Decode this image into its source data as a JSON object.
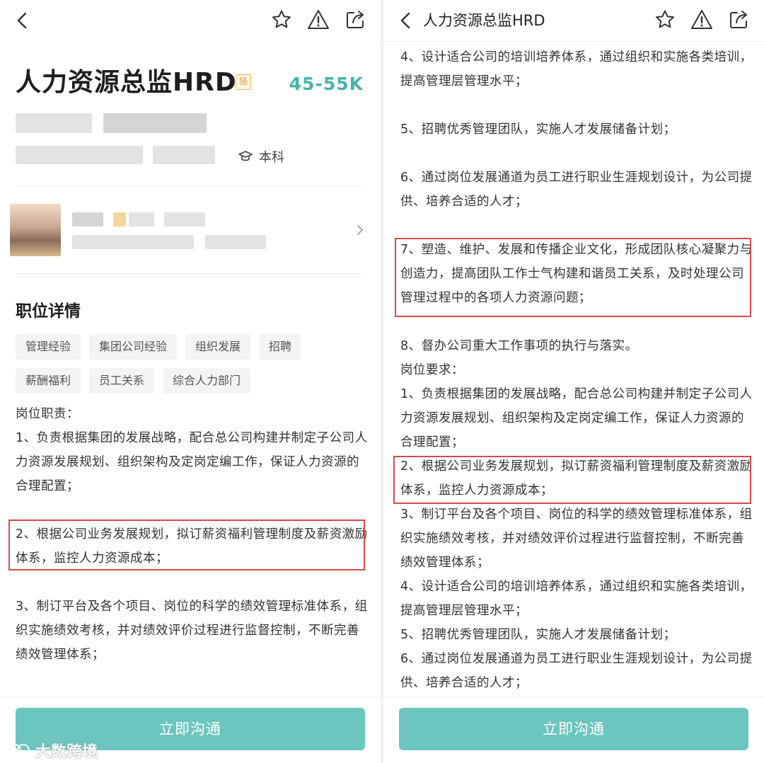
{
  "left": {
    "job_title": "人力资源总监HRD",
    "badge": "猎",
    "salary": "45-55K",
    "education": "本科",
    "section_title": "职位详情",
    "tags": [
      "管理经验",
      "集团公司经验",
      "组织发展",
      "招聘",
      "薪酬福利",
      "员工关系",
      "综合人力部门"
    ],
    "duties_heading": "岗位职责：",
    "duty_1": "1、负责根据集团的发展战略，配合总公司构建并制定子公司人力资源发展规划、组织架构及定岗定编工作，保证人力资源的合理配置；",
    "duty_2": "2、根据公司业务发展规划，拟订薪资福利管理制度及薪资激励体系，监控人力资源成本；",
    "duty_3": "3、制订平台及各个项目、岗位的科学的绩效管理标准体系，组织实施绩效考核，并对绩效评价过程进行监督控制，不断完善绩效管理体系；",
    "cta": "立即沟通"
  },
  "right": {
    "top_title": "人力资源总监HRD",
    "p4": "4、设计适合公司的培训培养体系，通过组织和实施各类培训，提高管理层管理水平；",
    "p5": "5、招聘优秀管理团队，实施人才发展储备计划；",
    "p6": "6、通过岗位发展通道为员工进行职业生涯规划设计，为公司提供、培养合适的人才；",
    "p7": "7、塑造、维护、发展和传播企业文化，形成团队核心凝聚力与创造力，提高团队工作士气构建和谐员工关系，及时处理公司管理过程中的各项人力资源问题；",
    "p8": "8、督办公司重大工作事项的执行与落实。",
    "req_heading": "岗位要求：",
    "r1": "1、负责根据集团的发展战略，配合总公司构建并制定子公司人力资源发展规划、组织架构及定岗定编工作，保证人力资源的合理配置；",
    "r2": "2、根据公司业务发展规划，拟订薪资福利管理制度及薪资激励体系，监控人力资源成本；",
    "r3": "3、制订平台及各个项目、岗位的科学的绩效管理标准体系，组织实施绩效考核，并对绩效评价过程进行监督控制，不断完善绩效管理体系；",
    "r4": "4、设计适合公司的培训培养体系，通过组织和实施各类培训，提高管理层管理水平；",
    "r5": "5、招聘优秀管理团队，实施人才发展储备计划；",
    "r6": "6、通过岗位发展通道为员工进行职业生涯规划设计，为公司提供、培养合适的人才；",
    "cta": "立即沟通"
  },
  "watermark": "大数跨境",
  "icons": {
    "back": "chevron-left-icon",
    "star": "star-icon",
    "report": "warning-triangle-icon",
    "share": "share-icon",
    "education": "graduation-cap-icon",
    "more": "chevron-right-icon"
  },
  "colors": {
    "accent": "#6cc5be",
    "salary": "#4ab3a8",
    "highlight_box": "#d64a4a"
  }
}
